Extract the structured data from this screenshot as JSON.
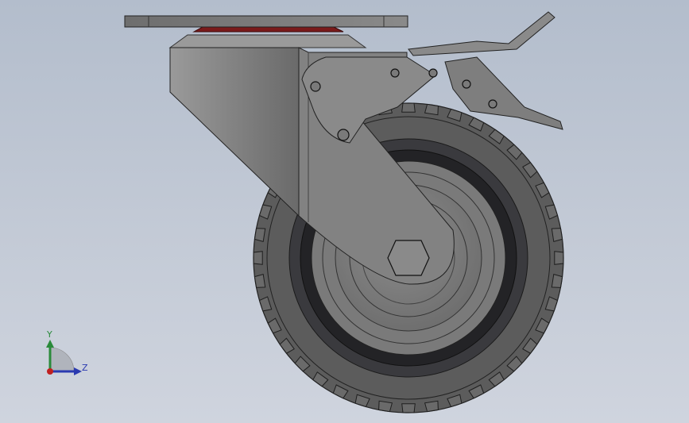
{
  "scene": {
    "background_top": "#b3bdcc",
    "background_bottom": "#cfd4de",
    "part_color": "#7e7e7e",
    "tire_color": "#5a5a5a",
    "rim_dark": "#2a2a2e",
    "bearing_color": "#7a1a1a"
  },
  "triad": {
    "y_label": "Y",
    "z_label": "Z",
    "y_color": "#2a8a3a",
    "z_color": "#2a3ab0",
    "x_color": "#c02020"
  }
}
